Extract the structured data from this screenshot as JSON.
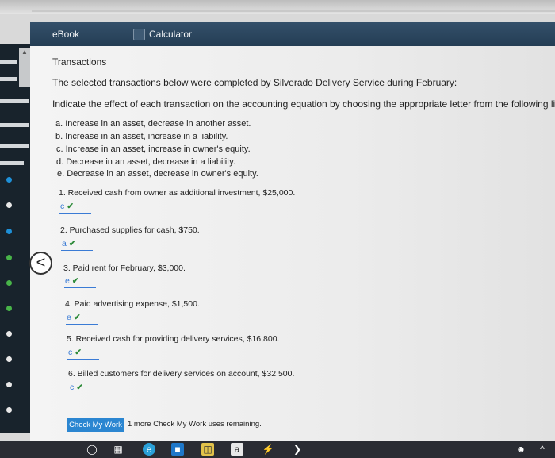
{
  "tabs": [
    {
      "label": "eBook",
      "icon": "book-icon"
    },
    {
      "label": "Calculator",
      "icon": "calculator-icon"
    }
  ],
  "content": {
    "heading": "Transactions",
    "intro": "The selected transactions below were completed by Silverado Delivery Service during February:",
    "instruction": "Indicate the effect of each transaction on the accounting equation by choosing the appropriate letter from the following list:",
    "options": [
      "a. Increase in an asset, decrease in another asset.",
      "b. Increase in an asset, increase in a liability.",
      "c. Increase in an asset, increase in owner's equity.",
      "d. Decrease in an asset, decrease in a liability.",
      "e. Decrease in an asset, decrease in owner's equity."
    ],
    "questions": [
      {
        "text": "1. Received cash from owner as additional investment, $25,000.",
        "answer": "c"
      },
      {
        "text": "2. Purchased supplies for cash, $750.",
        "answer": "a"
      },
      {
        "text": "3. Paid rent for February, $3,000.",
        "answer": "e"
      },
      {
        "text": "4. Paid advertising expense, $1,500.",
        "answer": "e"
      },
      {
        "text": "5. Received cash for providing delivery services, $16,800.",
        "answer": "c"
      },
      {
        "text": "6. Billed customers for delivery services on account, $32,500.",
        "answer": "c"
      }
    ]
  },
  "footer": {
    "check_button": "Check My Work",
    "remaining": "1 more Check My Work uses remaining."
  },
  "nav": {
    "prev": "<"
  },
  "taskbar": {
    "store_letter": "a"
  }
}
